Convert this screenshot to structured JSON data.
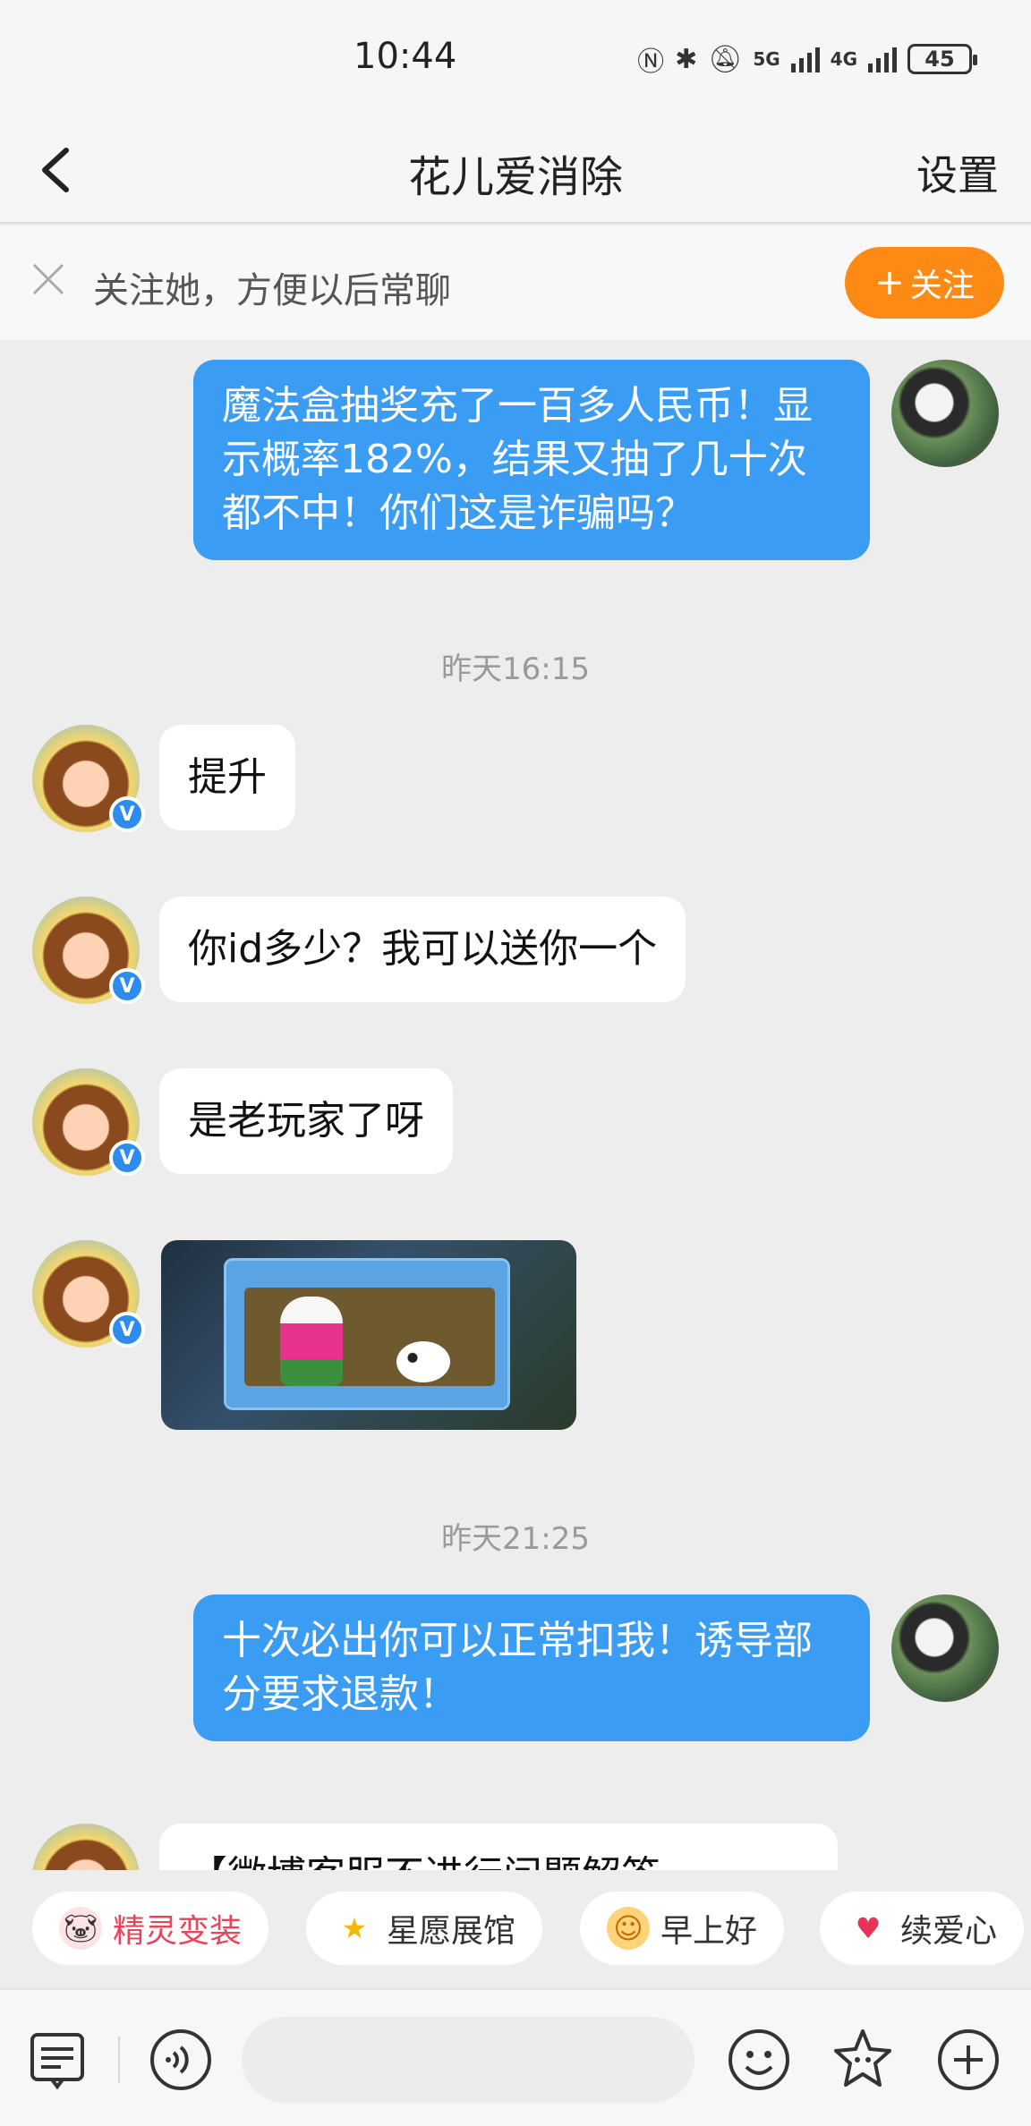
{
  "status_bar": {
    "time": "10:44",
    "network1": "5G",
    "network2": "4G",
    "battery": "45"
  },
  "nav": {
    "title": "花儿爱消除",
    "settings_label": "设置"
  },
  "follow_banner": {
    "text": "关注她，方便以后常聊",
    "button_label": "关注"
  },
  "messages": {
    "m1": {
      "text": "魔法盒抽奖充了一百多人民币！显示概率182%，结果又抽了几十次都不中！你们这是诈骗吗？"
    },
    "ts1": "昨天16:15",
    "m2": {
      "text": "提升"
    },
    "m3": {
      "text": "你id多少？我可以送你一个"
    },
    "m4": {
      "text": "是老玩家了呀"
    },
    "ts2": "昨天21:25",
    "m6": {
      "text": "十次必出你可以正常扣我！诱导部分要求退款！"
    },
    "m7": {
      "text": "【微博客服不进行问题解答"
    }
  },
  "quick_replies": [
    {
      "label": "精灵变装",
      "icon": "fairy-icon",
      "color": "#e8455a"
    },
    {
      "label": "星愿展馆",
      "icon": "star-icon",
      "color": "#333333"
    },
    {
      "label": "早上好",
      "icon": "sun-face-icon",
      "color": "#333333"
    },
    {
      "label": "续爱心",
      "icon": "heart-icon",
      "color": "#333333"
    }
  ],
  "colors": {
    "accent_orange": "#fe8a16",
    "bubble_blue": "#3b9cf4",
    "verify_blue": "#2d8cf0"
  }
}
